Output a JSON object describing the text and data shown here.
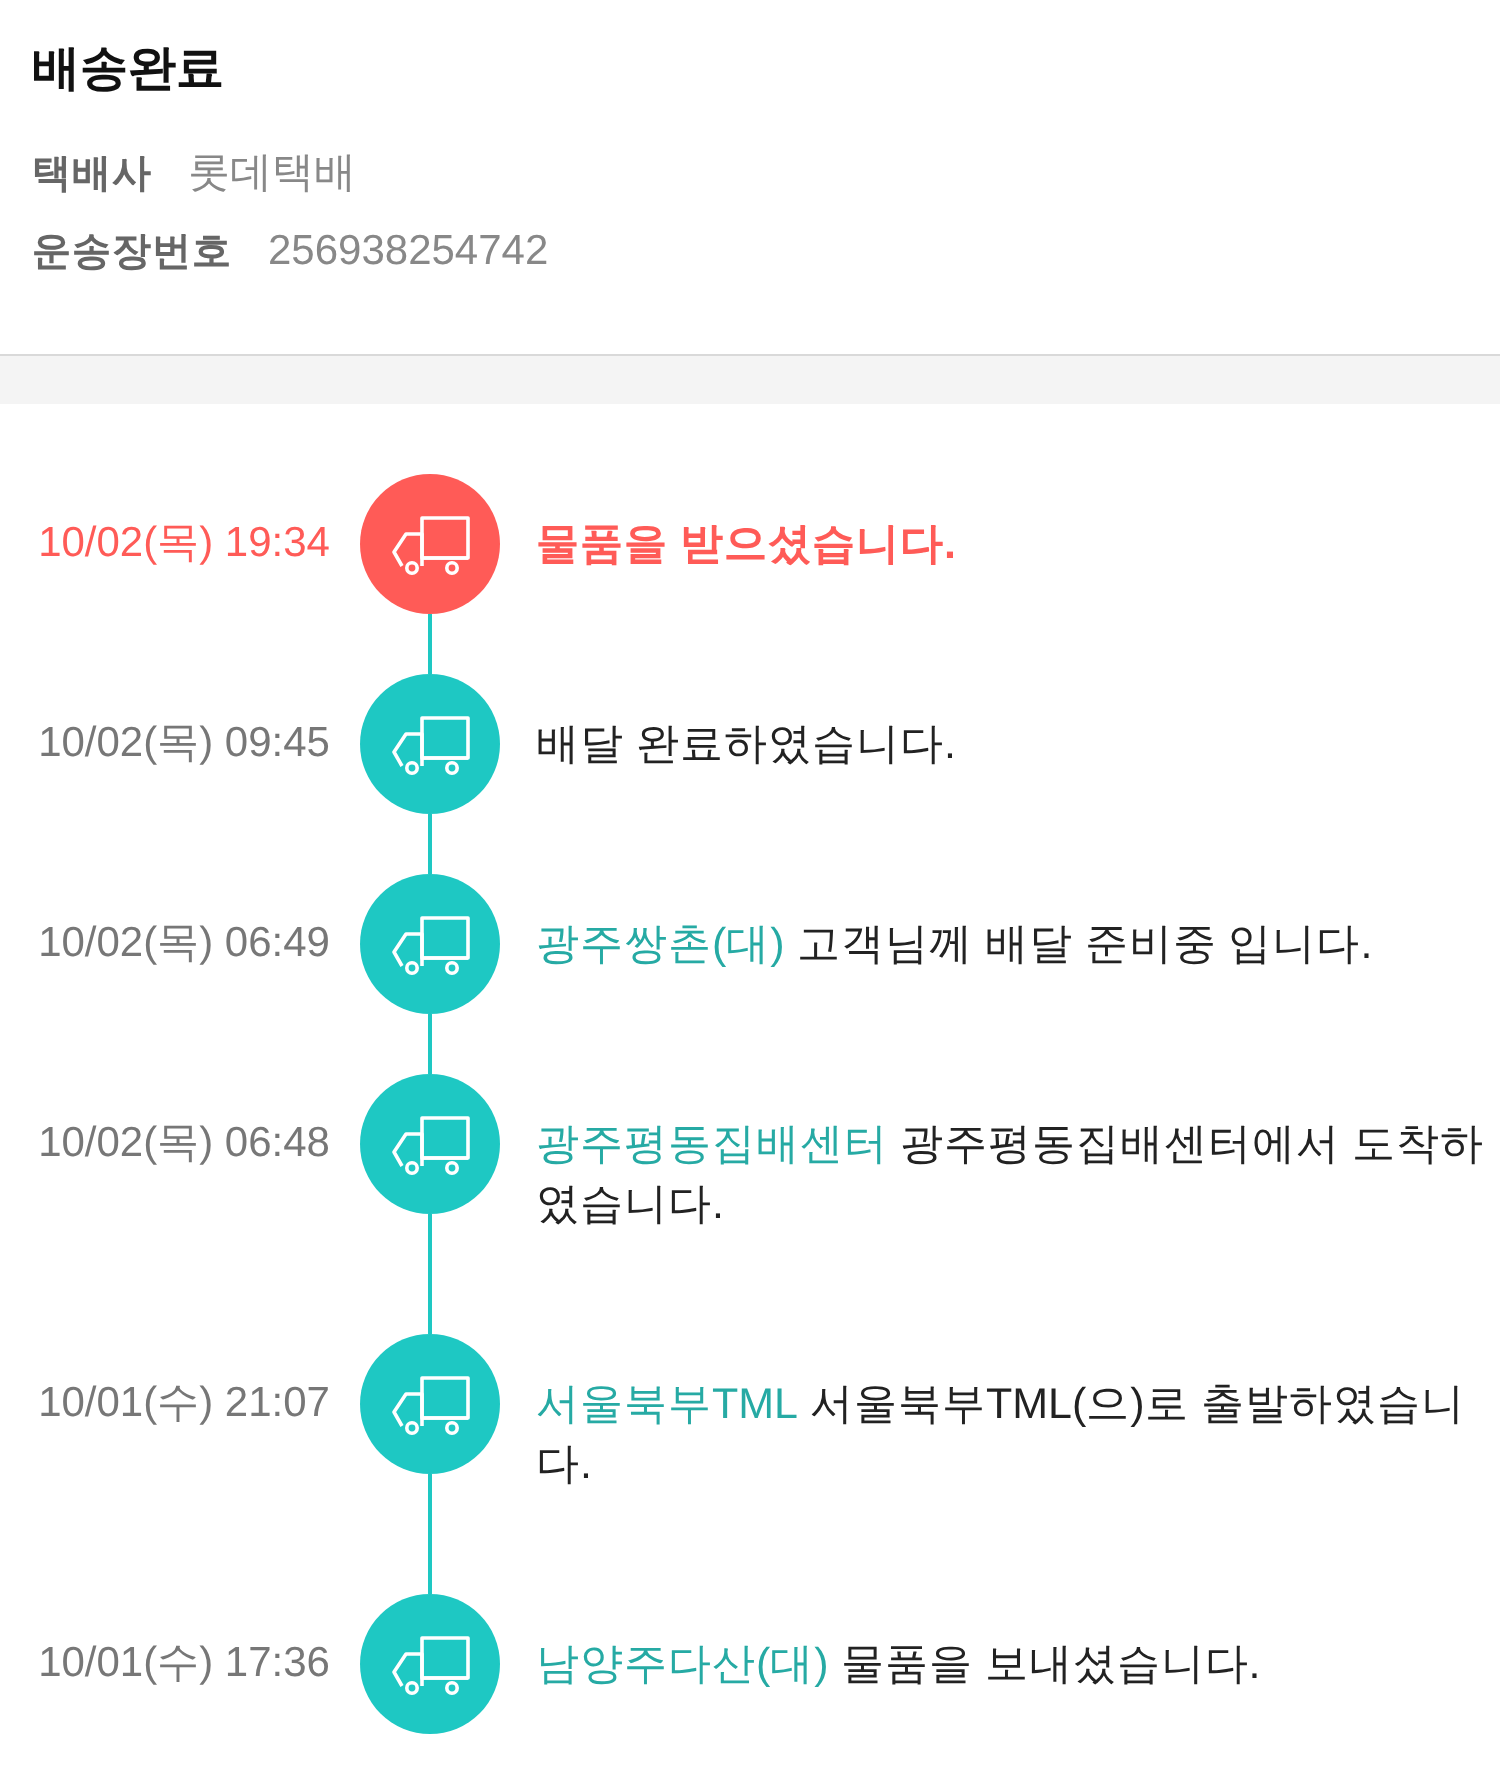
{
  "header": {
    "title": "배송완료",
    "fields": [
      {
        "label": "택배사",
        "value": "롯데택배"
      },
      {
        "label": "운송장번호",
        "value": "256938254742"
      }
    ]
  },
  "timeline": {
    "events": [
      {
        "time": "10/02(목) 19:34",
        "message": "물품을 받으셨습니다.",
        "current": true
      },
      {
        "time": "10/02(목) 09:45",
        "message": "배달 완료하였습니다.",
        "current": false
      },
      {
        "time": "10/02(목) 06:49",
        "location": "광주쌍촌(대)",
        "message": "고객님께 배달 준비중 입니다.",
        "current": false
      },
      {
        "time": "10/02(목) 06:48",
        "location": "광주평동집배센터",
        "message": "광주평동집배센터에서 도착하였습니다.",
        "current": false
      },
      {
        "time": "10/01(수) 21:07",
        "location": "서울북부TML",
        "message": "서울북부TML(으)로 출발하였습니다.",
        "current": false
      },
      {
        "time": "10/01(수) 17:36",
        "location": "남양주다산(대)",
        "message": "물품을 보내셨습니다.",
        "current": false
      }
    ]
  }
}
